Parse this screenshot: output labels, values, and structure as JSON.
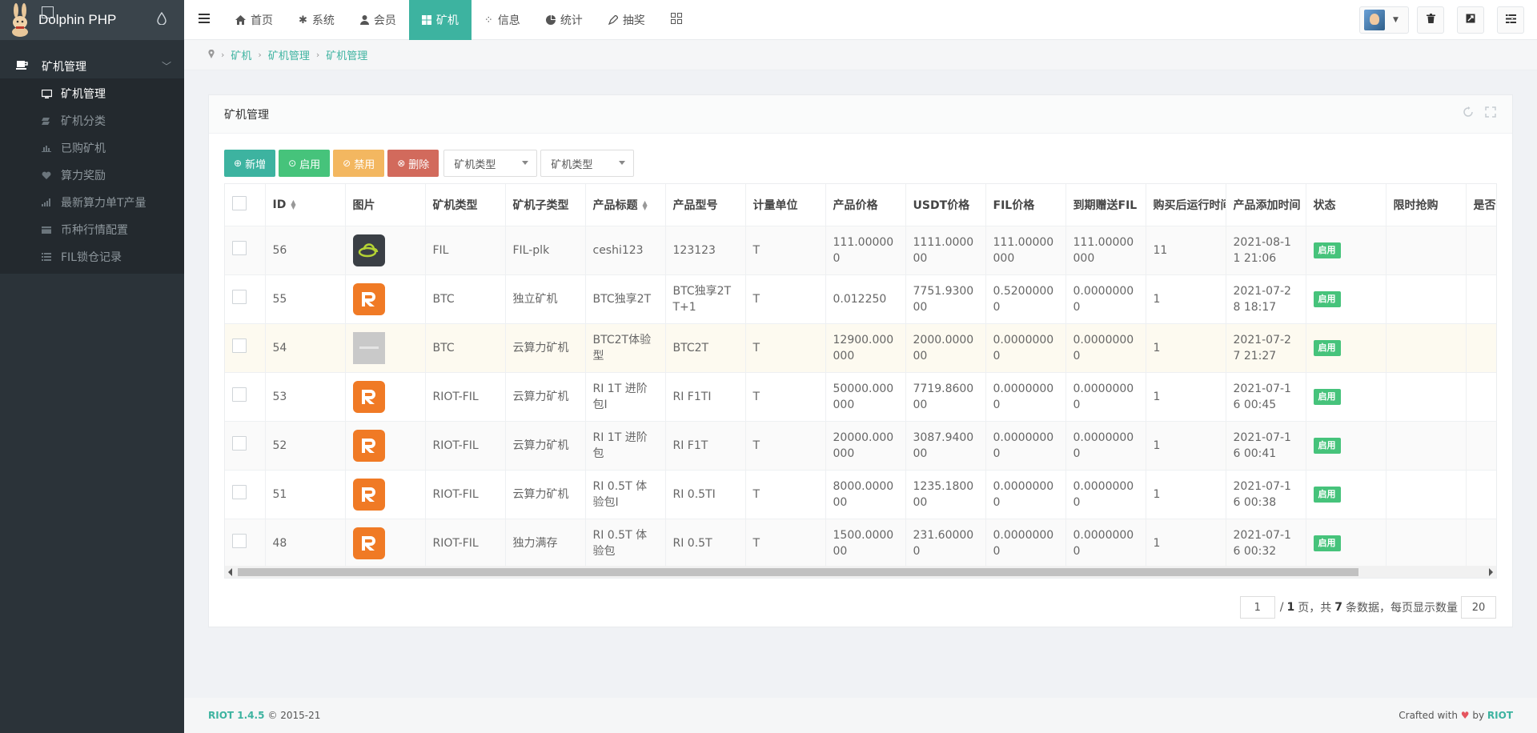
{
  "app": {
    "title": "Dolphin PHP"
  },
  "sidebar": {
    "group_label": "矿机管理",
    "items": [
      {
        "label": "矿机管理",
        "icon": "monitor-icon",
        "active": true
      },
      {
        "label": "矿机分类",
        "icon": "stack-icon"
      },
      {
        "label": "已购矿机",
        "icon": "bar-chart-icon"
      },
      {
        "label": "算力奖励",
        "icon": "heart-icon"
      },
      {
        "label": "最新算力单T产量",
        "icon": "signal-icon"
      },
      {
        "label": "币种行情配置",
        "icon": "card-icon"
      },
      {
        "label": "FIL锁仓记录",
        "icon": "list-icon"
      }
    ]
  },
  "topnav": {
    "items": [
      {
        "label": "首页",
        "icon": "home-icon"
      },
      {
        "label": "系统",
        "icon": "gear-icon"
      },
      {
        "label": "会员",
        "icon": "user-icon"
      },
      {
        "label": "矿机",
        "icon": "windows-icon",
        "active": true
      },
      {
        "label": "信息",
        "icon": "slack-icon"
      },
      {
        "label": "统计",
        "icon": "pie-chart-icon"
      },
      {
        "label": "抽奖",
        "icon": "pen-icon"
      }
    ]
  },
  "breadcrumb": [
    "矿机",
    "矿机管理",
    "矿机管理"
  ],
  "panel": {
    "title": "矿机管理",
    "toolbar": {
      "add": "新增",
      "enable": "启用",
      "disable": "禁用",
      "delete": "删除",
      "select1": "矿机类型",
      "select2": "矿机类型"
    }
  },
  "table": {
    "columns": [
      "",
      "ID",
      "图片",
      "矿机类型",
      "矿机子类型",
      "产品标题",
      "产品型号",
      "计量单位",
      "产品价格",
      "USDT价格",
      "FIL价格",
      "到期赠送FIL",
      "购买后运行时间",
      "产品添加时间",
      "状态",
      "限时抢购",
      "是否"
    ],
    "rows": [
      {
        "id": "56",
        "img": "fil",
        "type": "FIL",
        "subtype": "FIL-plk",
        "title": "ceshi123",
        "model": "123123",
        "unit": "T",
        "price": "111.000000",
        "usdt": "1111.000000",
        "fil": "111.00000000",
        "bonus": "111.00000000",
        "runtime": "11",
        "added": "2021-08-11 21:06",
        "status": "启用"
      },
      {
        "id": "55",
        "img": "r",
        "type": "BTC",
        "subtype": "独立矿机",
        "title": "BTC独享2T",
        "model": "BTC独享2T T+1",
        "unit": "T",
        "price": "0.012250",
        "usdt": "7751.930000",
        "fil": "0.52000000",
        "bonus": "0.00000000",
        "runtime": "1",
        "added": "2021-07-28 18:17",
        "status": "启用"
      },
      {
        "id": "54",
        "img": "gray",
        "type": "BTC",
        "subtype": "云算力矿机",
        "title": "BTC2T体验型",
        "model": "BTC2T",
        "unit": "T",
        "price": "12900.000000",
        "usdt": "2000.000000",
        "fil": "0.00000000",
        "bonus": "0.00000000",
        "runtime": "1",
        "added": "2021-07-27 21:27",
        "status": "启用"
      },
      {
        "id": "53",
        "img": "r",
        "type": "RIOT-FIL",
        "subtype": "云算力矿机",
        "title": "RI 1T 进阶包I",
        "model": "RI F1TI",
        "unit": "T",
        "price": "50000.000000",
        "usdt": "7719.860000",
        "fil": "0.00000000",
        "bonus": "0.00000000",
        "runtime": "1",
        "added": "2021-07-16 00:45",
        "status": "启用"
      },
      {
        "id": "52",
        "img": "r",
        "type": "RIOT-FIL",
        "subtype": "云算力矿机",
        "title": "RI 1T 进阶包",
        "model": "RI F1T",
        "unit": "T",
        "price": "20000.000000",
        "usdt": "3087.940000",
        "fil": "0.00000000",
        "bonus": "0.00000000",
        "runtime": "1",
        "added": "2021-07-16 00:41",
        "status": "启用"
      },
      {
        "id": "51",
        "img": "r",
        "type": "RIOT-FIL",
        "subtype": "云算力矿机",
        "title": "RI 0.5T 体验包I",
        "model": "RI 0.5TI",
        "unit": "T",
        "price": "8000.000000",
        "usdt": "1235.180000",
        "fil": "0.00000000",
        "bonus": "0.00000000",
        "runtime": "1",
        "added": "2021-07-16 00:38",
        "status": "启用"
      },
      {
        "id": "48",
        "img": "r",
        "type": "RIOT-FIL",
        "subtype": "独力满存",
        "title": "RI 0.5T 体验包",
        "model": "RI 0.5T",
        "unit": "T",
        "price": "1500.000000",
        "usdt": "231.600000",
        "fil": "0.00000000",
        "bonus": "0.00000000",
        "runtime": "1",
        "added": "2021-07-16 00:32",
        "status": "启用"
      }
    ]
  },
  "pagination": {
    "page": "1",
    "text_pages": "/",
    "total_pages": "1",
    "text_mid": "页，共",
    "total_rows": "7",
    "text_end": "条数据，每页显示数量",
    "per_page": "20"
  },
  "footer": {
    "version": "RIOT 1.4.5",
    "copyright": "© 2015-21",
    "crafted": "Crafted with",
    "by": "by",
    "brand": "RIOT"
  },
  "colors": {
    "accent": "#3db3a0",
    "sidebar": "#2b3339",
    "success": "#46c37b",
    "warning": "#f3b760",
    "danger": "#d26a5c"
  }
}
